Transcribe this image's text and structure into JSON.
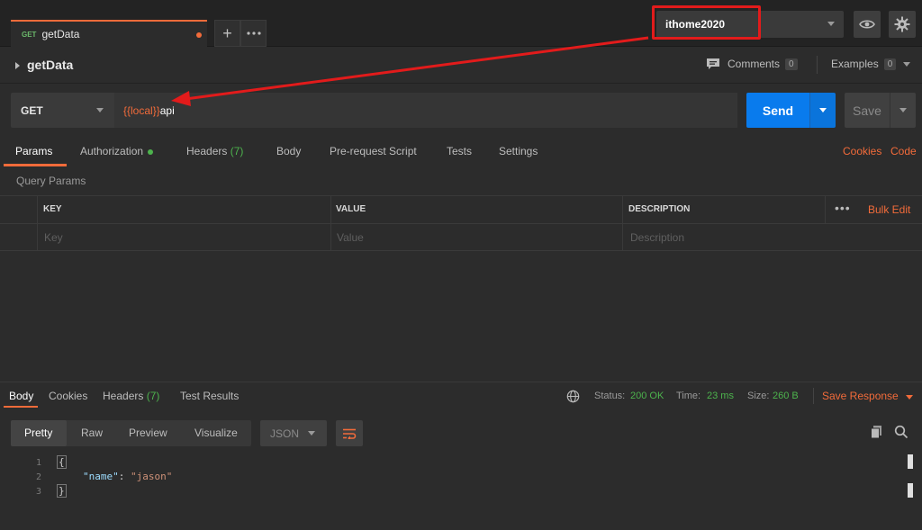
{
  "tab": {
    "method": "GET",
    "name": "getData"
  },
  "environment": {
    "name": "ithome2020"
  },
  "request": {
    "title": "getData",
    "comments_label": "Comments",
    "comments_count": "0",
    "examples_label": "Examples",
    "examples_count": "0",
    "method": "GET",
    "url_variable": "{{local}}",
    "url_rest": "api",
    "send_label": "Send",
    "save_label": "Save"
  },
  "request_tabs": {
    "params": "Params",
    "authorization": "Authorization",
    "headers": "Headers",
    "headers_count": "(7)",
    "body": "Body",
    "pre_request": "Pre-request Script",
    "tests": "Tests",
    "settings": "Settings",
    "cookies": "Cookies",
    "code": "Code"
  },
  "params": {
    "section_label": "Query Params",
    "columns": [
      "KEY",
      "VALUE",
      "DESCRIPTION"
    ],
    "placeholders": [
      "Key",
      "Value",
      "Description"
    ],
    "more": "•••",
    "bulk_edit": "Bulk Edit"
  },
  "response": {
    "tabs": {
      "body": "Body",
      "cookies": "Cookies",
      "headers": "Headers",
      "headers_count": "(7)",
      "test_results": "Test Results"
    },
    "status_label": "Status:",
    "status_value": "200 OK",
    "time_label": "Time:",
    "time_value": "23 ms",
    "size_label": "Size:",
    "size_value": "260 B",
    "save_response": "Save Response",
    "views": [
      "Pretty",
      "Raw",
      "Preview",
      "Visualize"
    ],
    "format": "JSON",
    "code_lines": {
      "ln1": "1",
      "ln2": "2",
      "ln3": "3",
      "open": "{",
      "key": "\"name\"",
      "colon": ": ",
      "value": "\"jason\"",
      "close": "}"
    }
  },
  "colors": {
    "accent": "#f26b3a",
    "send": "#097bed",
    "success": "#4db34d",
    "annotation": "#e21b1b"
  },
  "icons": [
    "plus-icon",
    "more-icon",
    "eye-icon",
    "gear-icon",
    "comment-icon",
    "globe-icon",
    "copy-icon",
    "search-icon",
    "wrap-icon"
  ]
}
